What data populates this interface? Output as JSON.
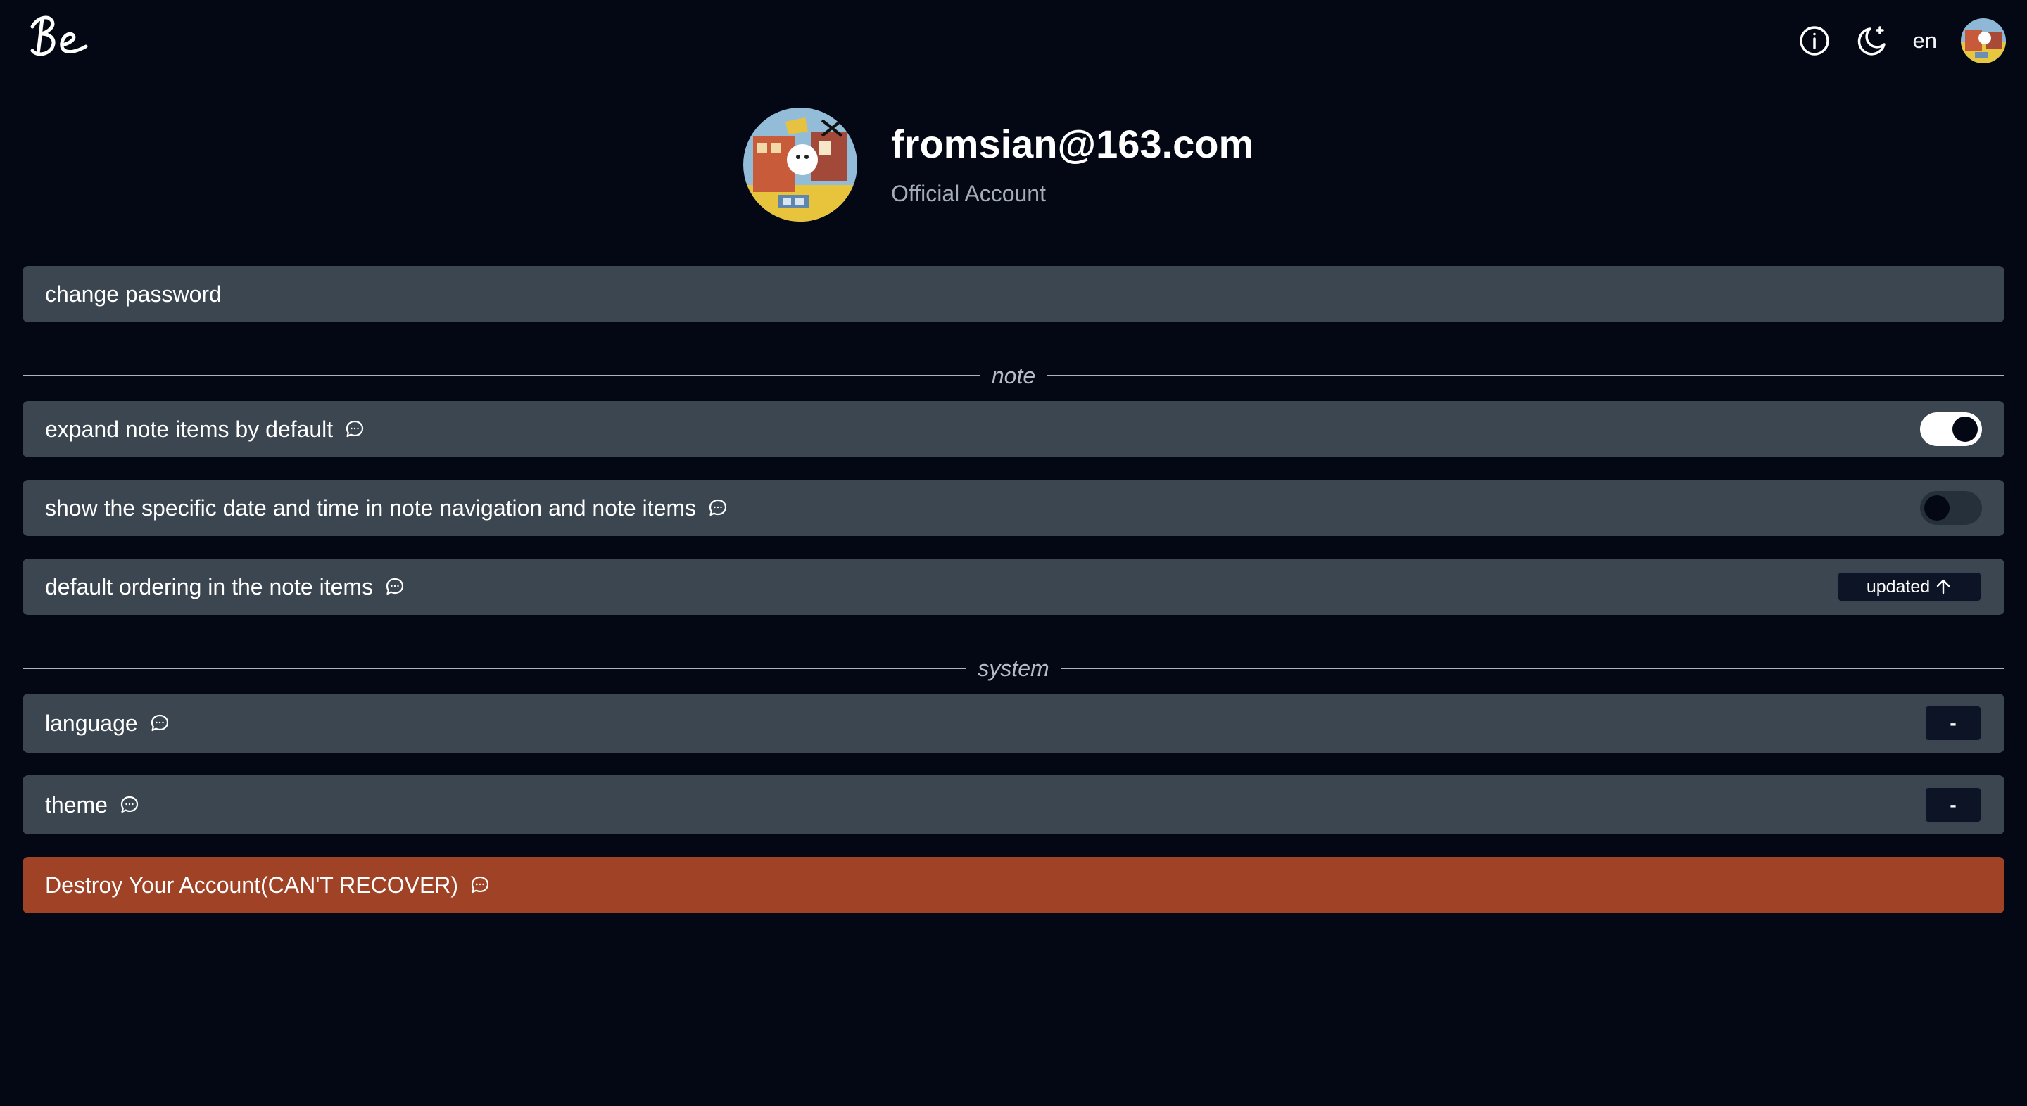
{
  "header": {
    "logo_text": "Be",
    "info_icon": "info-icon",
    "theme_icon": "moon-star-icon",
    "language": "en",
    "avatar_icon": "user-avatar"
  },
  "profile": {
    "email": "fromsian@163.com",
    "subtitle": "Official Account"
  },
  "settings": {
    "change_password": "change password",
    "note_section": "note",
    "expand_note_items": {
      "label": "expand note items by default",
      "enabled": true
    },
    "show_date_time": {
      "label": "show the specific date and time in note navigation and note items",
      "enabled": false
    },
    "default_ordering": {
      "label": "default ordering in the note items",
      "value": "updated"
    },
    "system_section": "system",
    "language": {
      "label": "language",
      "value": "-"
    },
    "theme": {
      "label": "theme",
      "value": "-"
    },
    "destroy_account": "Destroy Your Account(CAN'T RECOVER)"
  },
  "colors": {
    "background": "#030814",
    "row": "#3b4650",
    "danger": "#a04226"
  }
}
